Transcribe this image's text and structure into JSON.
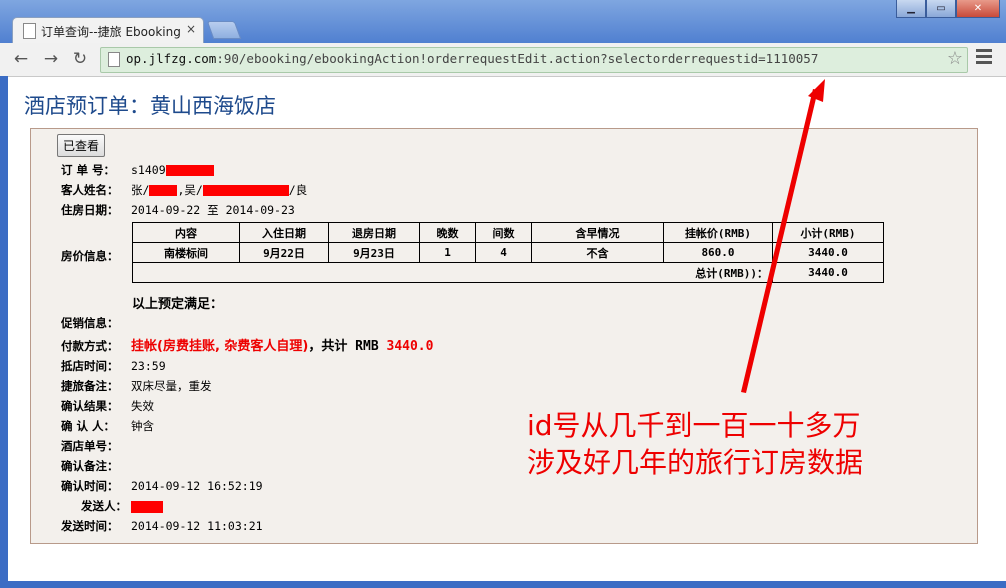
{
  "browser": {
    "tab_title": "订单查询--捷旅 Ebooking",
    "tab_close": "×",
    "url_host": "op.jlfzg.com",
    "url_rest": ":90/ebooking/ebookingAction!orderrequestEdit.action?selectorderrequestid=1110057",
    "back_glyph": "←",
    "forward_glyph": "→",
    "reload_glyph": "↻",
    "star_glyph": "☆",
    "min_glyph": "▁",
    "max_glyph": "▭",
    "close_glyph": "✕"
  },
  "page": {
    "title": "酒店预订单：黄山西海饭店",
    "viewed_button": "已查看"
  },
  "order": {
    "order_no_label": "订 单 号：",
    "order_no_value": "s1409",
    "guest_label": "客人姓名：",
    "guest_part1": "张/",
    "guest_part2": ",吴/",
    "guest_part3": "/良",
    "stay_label": "住房日期：",
    "stay_value": "2014-09-22 至 2014-09-23",
    "rate_label": "房价信息：",
    "satisfied": "以上预定满足：",
    "promo_label": "促销信息：",
    "pay_label": "付款方式：",
    "pay_method": "挂帐(房费挂账, 杂费客人自理)",
    "pay_mid": "，共计 RMB",
    "pay_amount": "3440.0",
    "arrive_label": "抵店时间：",
    "arrive_value": "23:59",
    "remark_label": "捷旅备注：",
    "remark_value": "双床尽量，重发",
    "confirm_result_label": "确认结果：",
    "confirm_result_value": "失效",
    "confirmer_label": "确 认 人：",
    "confirmer_value": "钟含",
    "hotel_no_label": "酒店单号：",
    "confirm_remark_label": "确认备注：",
    "confirm_time_label": "确认时间：",
    "confirm_time_value": "2014-09-12 16:52:19",
    "sender_label": "发送人：",
    "send_time_label": "发送时间：",
    "send_time_value": "2014-09-12 11:03:21"
  },
  "rate_table": {
    "headers": [
      "内容",
      "入住日期",
      "退房日期",
      "晚数",
      "间数",
      "含早情况",
      "挂帐价(RMB)",
      "小计(RMB)"
    ],
    "row": [
      "南楼标间",
      "9月22日",
      "9月23日",
      "1",
      "4",
      "不含",
      "860.0",
      "3440.0"
    ],
    "total_label": "总计(RMB))：",
    "total_value": "3440.0"
  },
  "annotation": {
    "line1": "id号从几千到一百一十多万",
    "line2": "涉及好几年的旅行订房数据",
    "color": "#ee0000"
  }
}
